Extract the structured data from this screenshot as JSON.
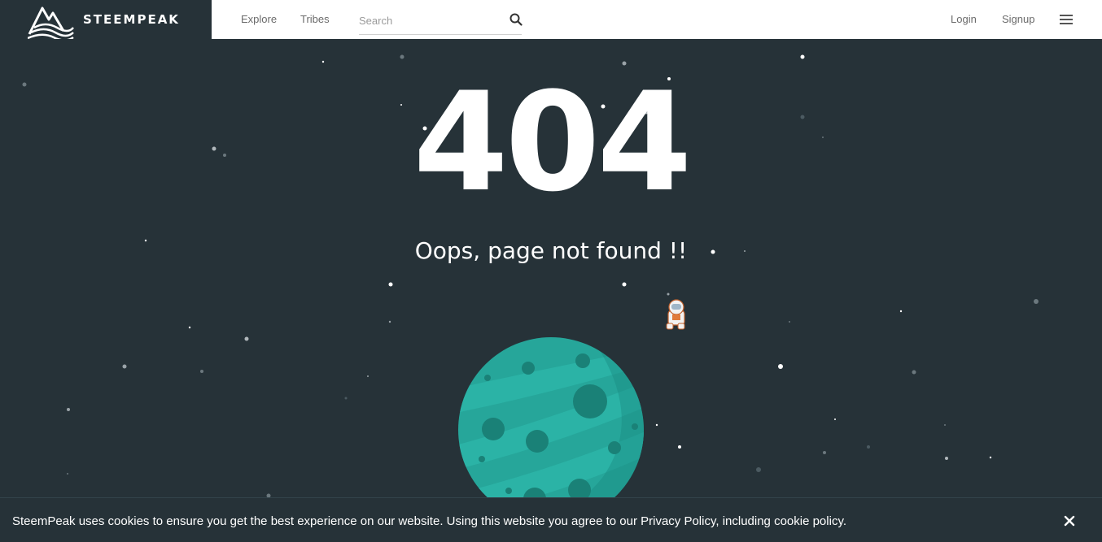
{
  "brand": {
    "name": "STEEMPEAK",
    "logo_icon": "mountain-logo-icon"
  },
  "nav": {
    "explore": "Explore",
    "tribes": "Tribes",
    "login": "Login",
    "signup": "Signup"
  },
  "search": {
    "placeholder": "Search",
    "value": "",
    "icon": "search-icon"
  },
  "menu": {
    "icon": "hamburger-menu-icon"
  },
  "error": {
    "code": "404",
    "message": "Oops, page not found !!"
  },
  "illustration": {
    "planet": "planet-illustration",
    "astronaut": "astronaut-illustration"
  },
  "cookie_banner": {
    "text": "SteemPeak uses cookies to ensure you get the best experience on our website. Using this website you agree to our Privacy Policy, including cookie policy.",
    "close_icon": "close-icon"
  },
  "colors": {
    "background": "#263238",
    "topbar": "#ffffff",
    "planet": "#26a69a",
    "planet_dark": "#1b8c82",
    "text_light": "#ffffff"
  }
}
